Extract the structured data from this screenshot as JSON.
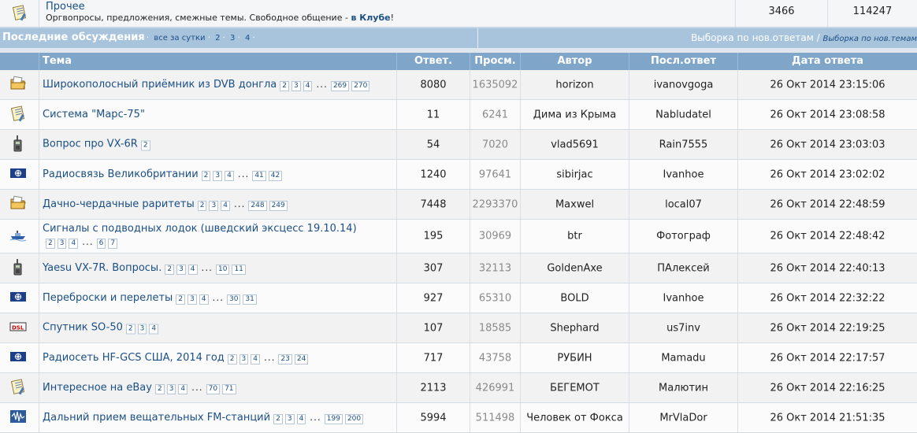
{
  "top_forum": {
    "icon": "notepad-icon",
    "name": "Прочее",
    "description_text": "Оргвопросы, предложения, смежные темы. Свободное общение - ",
    "description_link": "в Клубе",
    "description_end": "!",
    "topics": "3466",
    "posts": "114247"
  },
  "section": {
    "title": "Последние обсуждения",
    "all_day": "все за сутки",
    "pages": [
      "2",
      "3",
      "4"
    ],
    "right_label": "Выборка по нов.ответам",
    "right_sep": " / ",
    "right_small": "Выборка по нов.темам"
  },
  "columns": {
    "topic": "Тема",
    "replies": "Ответ.",
    "views": "Просм.",
    "author": "Автор",
    "last": "Посл.ответ",
    "date": "Дата ответа"
  },
  "rows": [
    {
      "icon": "folder-icon",
      "title": "Широкополосный приёмник из DVB донгла",
      "pages": [
        "2",
        "3",
        "4"
      ],
      "last_pages": [
        "269",
        "270"
      ],
      "replies": "8080",
      "views": "1635092",
      "author": "horizon",
      "last": "ivanovgoga",
      "date": "26 Окт 2014 23:15:06"
    },
    {
      "icon": "notepad-icon",
      "title": "Система \"Марс-75\"",
      "pages": [],
      "last_pages": [],
      "replies": "11",
      "views": "6241",
      "author": "Дима из Крыма",
      "last": "Nabludatel",
      "date": "26 Окт 2014 23:08:58"
    },
    {
      "icon": "radio-icon",
      "title": "Вопрос про VX-6R",
      "pages": [
        "2"
      ],
      "last_pages": [],
      "replies": "54",
      "views": "7020",
      "author": "vlad5691",
      "last": "Rain7555",
      "date": "26 Окт 2014 23:03:03"
    },
    {
      "icon": "nato-icon",
      "title": "Радиосвязь Великобритании",
      "pages": [
        "2",
        "3",
        "4"
      ],
      "last_pages": [
        "41",
        "42"
      ],
      "replies": "1240",
      "views": "97641",
      "author": "sibirjac",
      "last": "Ivanhoe",
      "date": "26 Окт 2014 23:02:02"
    },
    {
      "icon": "folder-icon",
      "title": "Дачно-чердачные раритеты",
      "pages": [
        "2",
        "3",
        "4"
      ],
      "last_pages": [
        "248",
        "249"
      ],
      "replies": "7448",
      "views": "2293370",
      "author": "Maxwel",
      "last": "local07",
      "date": "26 Окт 2014 22:48:59"
    },
    {
      "icon": "ship-icon",
      "title": "Сигналы с подводных лодок (шведский эксцесс 19.10.14)",
      "pages": [
        "2",
        "3",
        "4"
      ],
      "last_pages": [
        "6",
        "7"
      ],
      "replies": "195",
      "views": "30969",
      "author": "btr",
      "last": "Фотограф",
      "date": "26 Окт 2014 22:48:42",
      "tall": true
    },
    {
      "icon": "radio-icon",
      "title": "Yaesu VX-7R. Вопросы.",
      "pages": [
        "2",
        "3",
        "4"
      ],
      "last_pages": [
        "10",
        "11"
      ],
      "replies": "307",
      "views": "32113",
      "author": "GoldenAxe",
      "last": "ПАлексей",
      "date": "26 Окт 2014 22:40:13"
    },
    {
      "icon": "nato-icon",
      "title": "Переброски и перелеты",
      "pages": [
        "2",
        "3",
        "4"
      ],
      "last_pages": [
        "30",
        "31"
      ],
      "replies": "927",
      "views": "65310",
      "author": "BOLD",
      "last": "Ivanhoe",
      "date": "26 Окт 2014 22:32:22"
    },
    {
      "icon": "dsl-icon",
      "title": "Спутник SO-50",
      "pages": [
        "2",
        "3",
        "4"
      ],
      "last_pages": [],
      "replies": "107",
      "views": "18585",
      "author": "Shephard",
      "last": "us7inv",
      "date": "26 Окт 2014 22:19:25"
    },
    {
      "icon": "nato-icon",
      "title": "Радиосеть HF-GCS США, 2014 год",
      "pages": [
        "2",
        "3",
        "4"
      ],
      "last_pages": [
        "23",
        "24"
      ],
      "replies": "717",
      "views": "43758",
      "author": "РУБИН",
      "last": "Mamadu",
      "date": "26 Окт 2014 22:17:57"
    },
    {
      "icon": "notepad-icon",
      "title": "Интересное на eBay",
      "pages": [
        "2",
        "3",
        "4"
      ],
      "last_pages": [
        "70",
        "71"
      ],
      "replies": "2113",
      "views": "426991",
      "author": "БЕГЕМОТ",
      "last": "Малютин",
      "date": "26 Окт 2014 22:16:25"
    },
    {
      "icon": "fm-icon",
      "title": "Дальний прием вещательных FM-станций",
      "pages": [
        "2",
        "3",
        "4"
      ],
      "last_pages": [
        "199",
        "200"
      ],
      "replies": "5994",
      "views": "511498",
      "author": "Человек от Фокса",
      "last": "MrVlaDor",
      "date": "26 Окт 2014 21:51:35"
    }
  ]
}
